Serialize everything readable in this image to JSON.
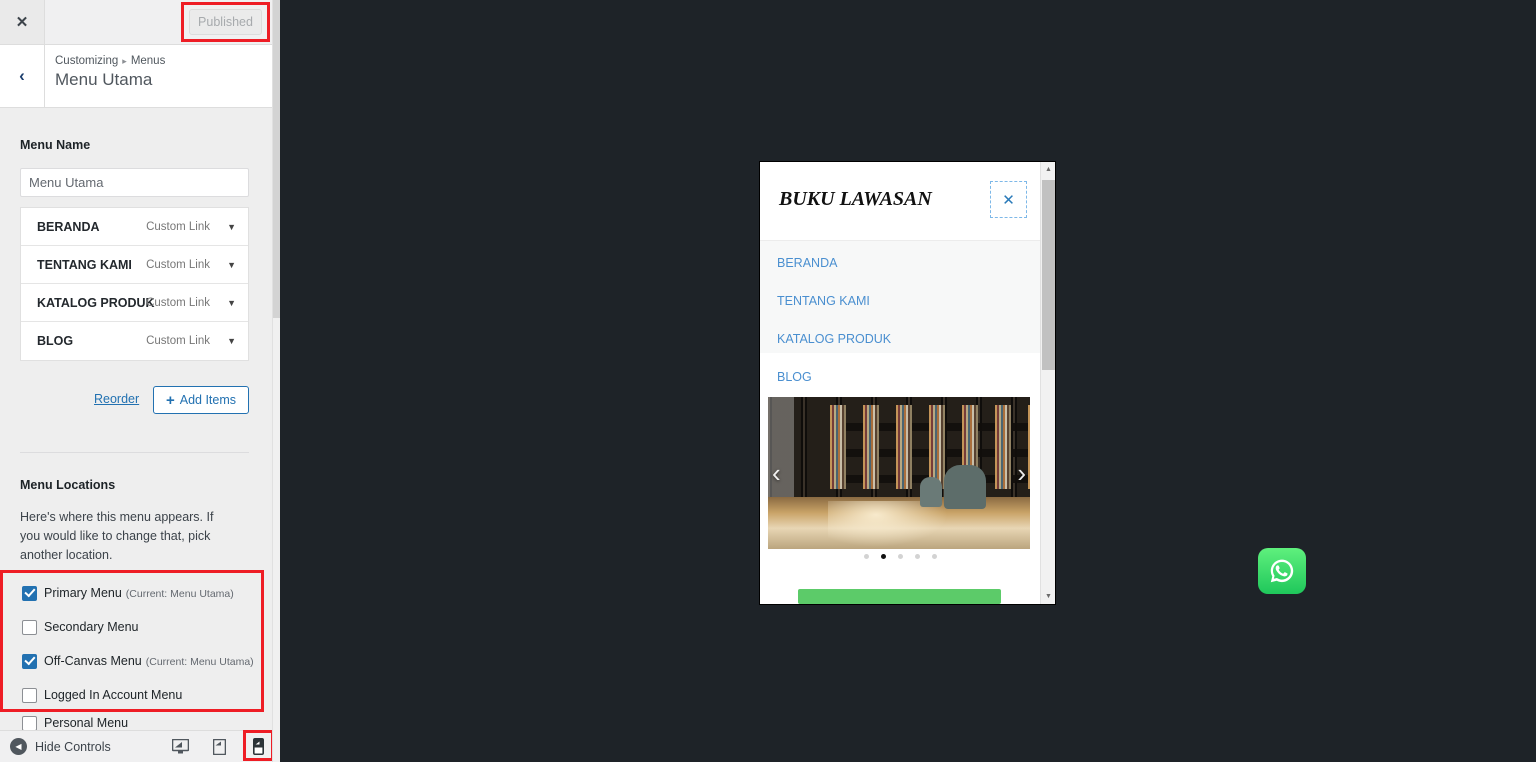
{
  "customizer": {
    "close_icon": "close-icon",
    "publish_button": "Published",
    "back_icon": "chevron-left-icon",
    "breadcrumb_root": "Customizing",
    "breadcrumb_sep": "▸",
    "breadcrumb_current": "Menus",
    "panel_title": "Menu Utama",
    "menu_name_label": "Menu Name",
    "menu_name_value": "Menu Utama",
    "menu_items": [
      {
        "title": "BERANDA",
        "type": "Custom Link",
        "caret": "▼"
      },
      {
        "title": "TENTANG KAMI",
        "type": "Custom Link",
        "caret": "▼"
      },
      {
        "title": "KATALOG PRODUK",
        "type": "Custom Link",
        "caret": "▼"
      },
      {
        "title": "BLOG",
        "type": "Custom Link",
        "caret": "▼"
      }
    ],
    "reorder_label": "Reorder",
    "add_items_label": "Add Items",
    "add_items_icon": "plus-icon",
    "menu_locations_title": "Menu Locations",
    "menu_locations_desc": "Here's where this menu appears. If you would like to change that, pick another location.",
    "locations": [
      {
        "label": "Primary Menu",
        "current": "(Current: Menu Utama)",
        "checked": true
      },
      {
        "label": "Secondary Menu",
        "current": "",
        "checked": false
      },
      {
        "label": "Off-Canvas Menu",
        "current": "(Current: Menu Utama)",
        "checked": true
      },
      {
        "label": "Logged In Account Menu",
        "current": "",
        "checked": false
      }
    ],
    "location_partial": {
      "label": "Personal Menu",
      "checked": false
    },
    "bottom_bar": {
      "hide_controls_label": "Hide Controls",
      "hide_controls_icon": "arrow-left-circle-icon",
      "devices": [
        {
          "name": "desktop-preview-icon",
          "active": false
        },
        {
          "name": "tablet-preview-icon",
          "active": false
        },
        {
          "name": "mobile-preview-icon",
          "active": true
        }
      ]
    }
  },
  "preview": {
    "site_logo": "BUKU LAWASAN",
    "offcanvas_close_icon": "close-icon",
    "offcanvas_close_glyph": "✕",
    "nav_links": [
      "BERANDA",
      "TENTANG KAMI",
      "KATALOG PRODUK",
      "BLOG"
    ],
    "hero": {
      "image_alt": "library-bookshelves-photo",
      "prev_icon": "chevron-left-icon",
      "next_icon": "chevron-right-icon",
      "prev_glyph": "‹",
      "next_glyph": "›",
      "dot_count": 5,
      "active_dot": 2
    },
    "whatsapp_icon": "whatsapp-icon",
    "scrollbar": {
      "up_glyph": "▲",
      "down_glyph": "▼"
    }
  },
  "colors": {
    "accent_blue": "#2271b1",
    "annotation_red": "#ee1d25",
    "whatsapp_green": "#25d366",
    "bar_green": "#5ccb69",
    "preview_backdrop": "#1e2328",
    "nav_link_blue": "#4a8fd0"
  }
}
